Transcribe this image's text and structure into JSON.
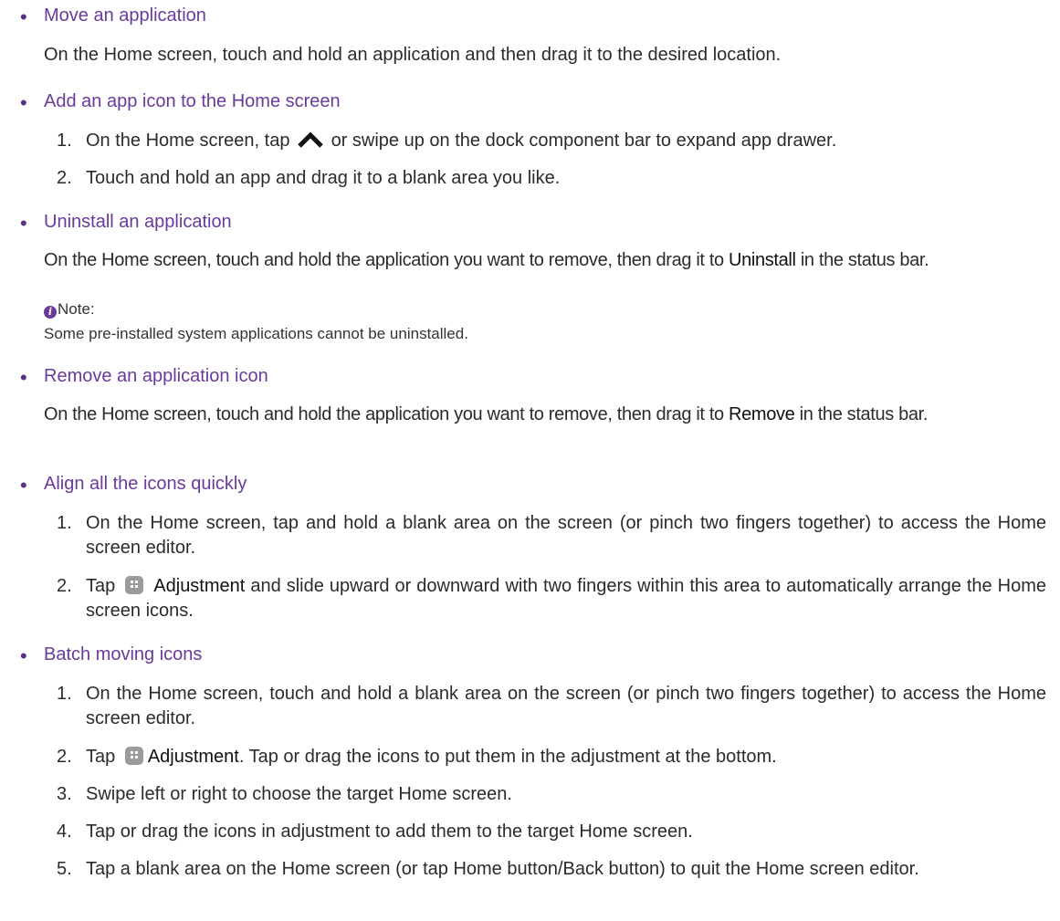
{
  "sections": [
    {
      "heading": "Move an application",
      "body": "On the Home screen, touch and hold an application and then drag it to the desired location."
    },
    {
      "heading": "Add an app icon to the Home screen",
      "steps": [
        {
          "num": "1.",
          "pre": "On the Home screen, tap",
          "post": "or swipe up on the dock component bar to expand app drawer."
        },
        {
          "num": "2.",
          "text": "Touch and hold an app and drag it to a blank area you like."
        }
      ]
    },
    {
      "heading": "Uninstall an application",
      "body_pre": "On the Home screen, touch and hold the application you want to remove, then drag it to",
      "body_bold": "Uninstall",
      "body_post": "in the status bar.",
      "note_label": "Note:",
      "note_text": "Some pre-installed system applications cannot be uninstalled."
    },
    {
      "heading": "Remove an application icon",
      "body_pre": "On the Home screen, touch and hold the application you want to remove, then drag it to",
      "body_bold": "Remove",
      "body_post": "in the status bar."
    },
    {
      "heading": "Align all the icons quickly",
      "steps": [
        {
          "num": "1.",
          "text": "On the Home screen, tap and hold a blank area on the screen (or pinch two fingers together) to access the Home screen editor."
        },
        {
          "num": "2.",
          "pre": "Tap",
          "bold": "Adjustment",
          "post": "and slide upward or downward with two fingers within this area to automatically arrange the Home screen icons."
        }
      ]
    },
    {
      "heading": "Batch moving icons",
      "steps": [
        {
          "num": "1.",
          "text": "On the Home screen, touch and hold a blank area on the screen (or pinch two fingers together) to access the Home screen editor."
        },
        {
          "num": "2.",
          "pre": "Tap",
          "bold": "Adjustment",
          "post": ". Tap or drag the icons to put them in the adjustment at the bottom."
        },
        {
          "num": "3.",
          "text": "Swipe left or right to choose the target Home screen."
        },
        {
          "num": "4.",
          "text": "Tap or drag the icons in adjustment to add them to the target Home screen."
        },
        {
          "num": "5.",
          "text": "Tap a blank area on the Home screen (or tap Home button/Back button) to quit the Home screen editor."
        }
      ]
    }
  ],
  "bullet_char": "•",
  "icons": {
    "chevron": "chevron-up-icon",
    "adjustment": "adjustment-icon",
    "info": "info-icon"
  },
  "colors": {
    "heading": "#6a3a9b",
    "text": "#2b2b2b"
  }
}
